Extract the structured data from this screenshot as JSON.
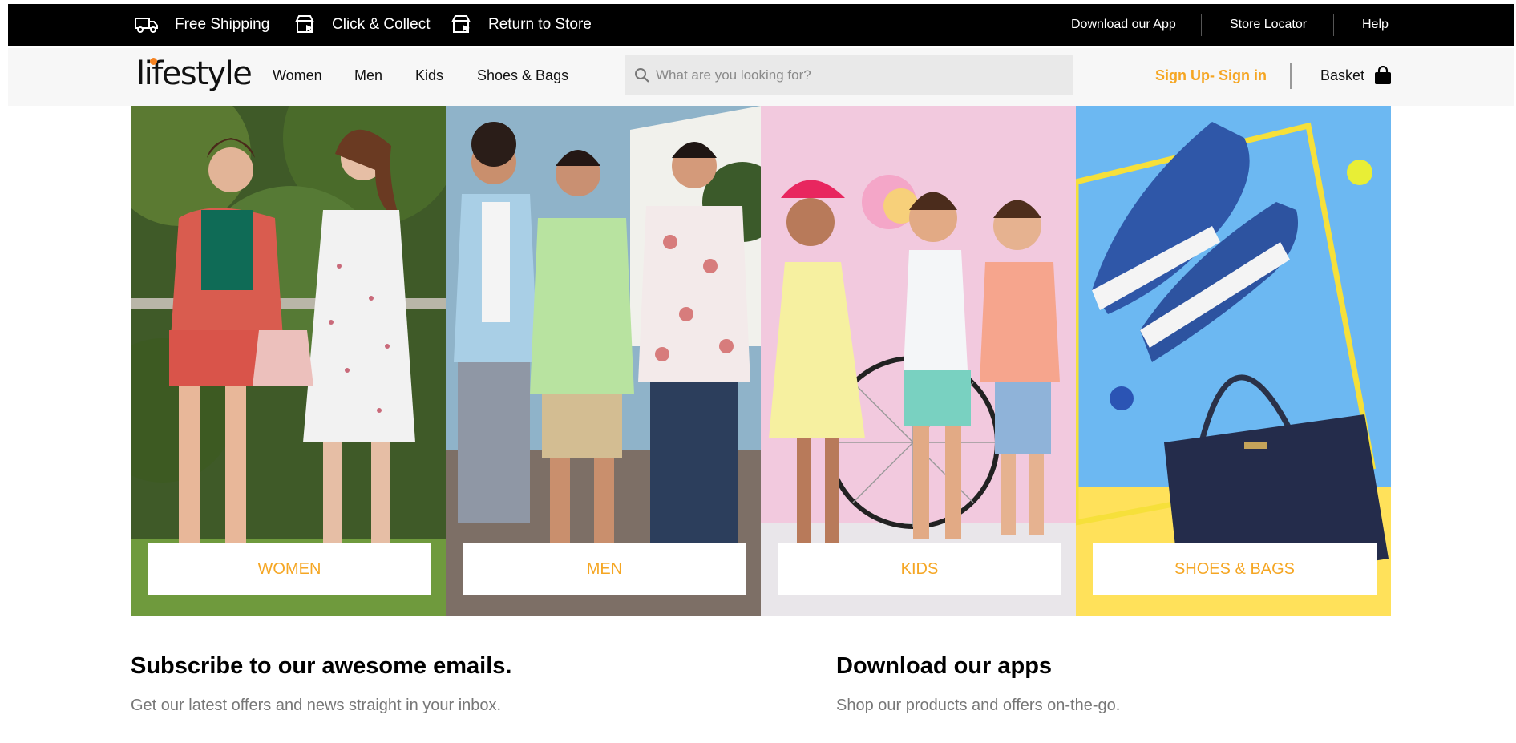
{
  "topbar": {
    "perks": [
      {
        "label": "Free Shipping",
        "icon": "truck-icon"
      },
      {
        "label": "Click & Collect",
        "icon": "store-pointer-icon"
      },
      {
        "label": "Return to Store",
        "icon": "store-pointer-icon"
      }
    ],
    "links": [
      "Download our App",
      "Store Locator",
      "Help"
    ]
  },
  "header": {
    "logo": "lifestyle",
    "nav": [
      "Women",
      "Men",
      "Kids",
      "Shoes & Bags"
    ],
    "search_placeholder": "What are you looking for?",
    "signin": "Sign Up- Sign in",
    "basket": "Basket"
  },
  "tiles": [
    {
      "label": "WOMEN"
    },
    {
      "label": "MEN"
    },
    {
      "label": "KIDS"
    },
    {
      "label": "SHOES & BAGS"
    }
  ],
  "subscribe": {
    "title": "Subscribe to our awesome emails.",
    "text": "Get our latest offers and news straight in your inbox."
  },
  "apps": {
    "title": "Download our apps",
    "text": "Shop our products and offers on-the-go."
  },
  "colors": {
    "accent": "#f5a623",
    "topbar_bg": "#000000",
    "header_bg": "#f7f7f7"
  }
}
